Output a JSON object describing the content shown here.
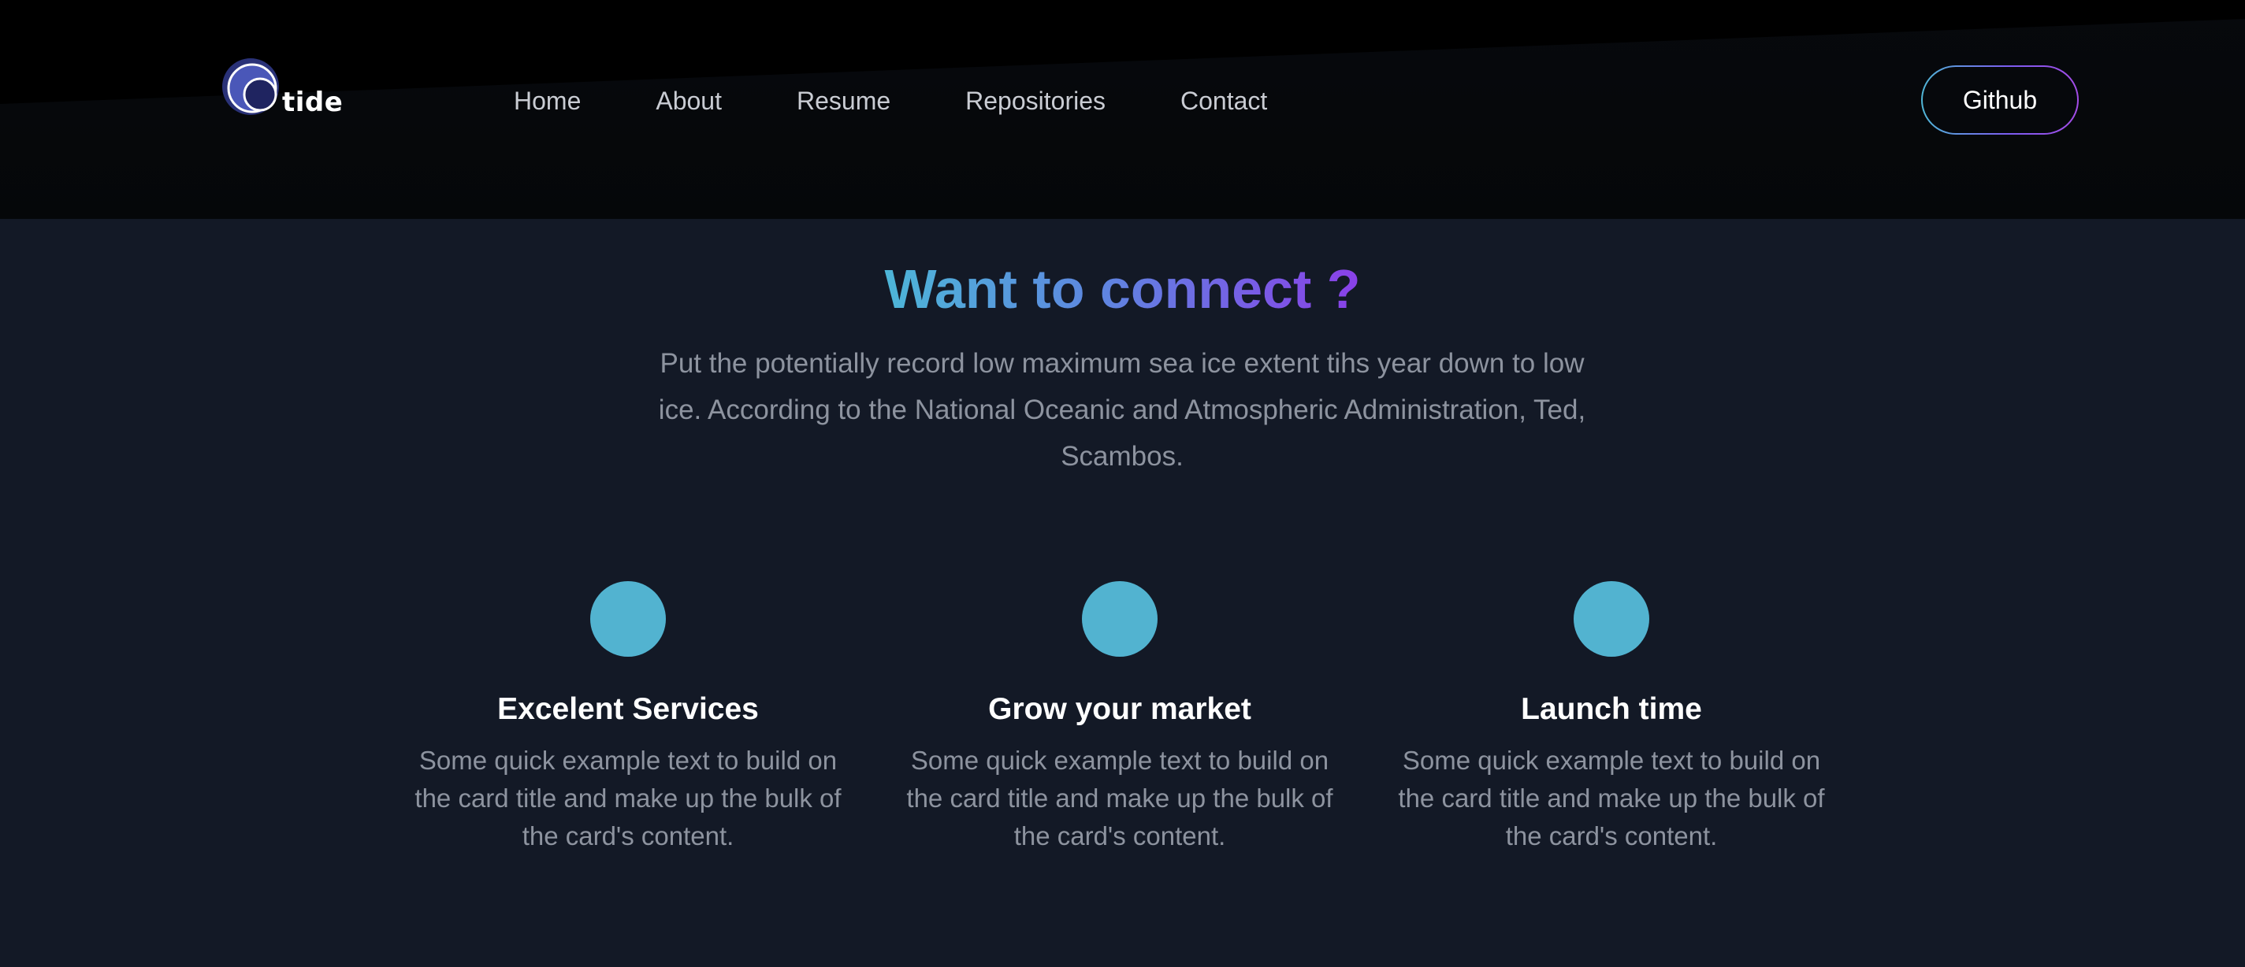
{
  "brand": {
    "name": "tide",
    "logo_icon": "tide-wave-logo-icon"
  },
  "nav": {
    "items": [
      {
        "label": "Home"
      },
      {
        "label": "About"
      },
      {
        "label": "Resume"
      },
      {
        "label": "Repositories"
      },
      {
        "label": "Contact"
      }
    ],
    "cta_label": "Github"
  },
  "connect": {
    "title": "Want to connect ?",
    "description": "Put the potentially record low maximum sea ice extent tihs year down to low ice. According to the National Oceanic and Atmospheric Administration, Ted, Scambos."
  },
  "features": [
    {
      "title": "Excelent Services",
      "text": "Some quick example text to build on the card title and make up the bulk of the card's content."
    },
    {
      "title": "Grow your market",
      "text": "Some quick example text to build on the card title and make up the bulk of the card's content."
    },
    {
      "title": "Launch time",
      "text": "Some quick example text to build on the card title and make up the bulk of the card's content."
    }
  ],
  "colors": {
    "background": "#131926",
    "header_background": "#06080c",
    "accent_cyan": "#4db6d8",
    "accent_purple": "#8a40e8",
    "feature_dot": "#52b3d0",
    "muted_text": "#8d939f"
  }
}
